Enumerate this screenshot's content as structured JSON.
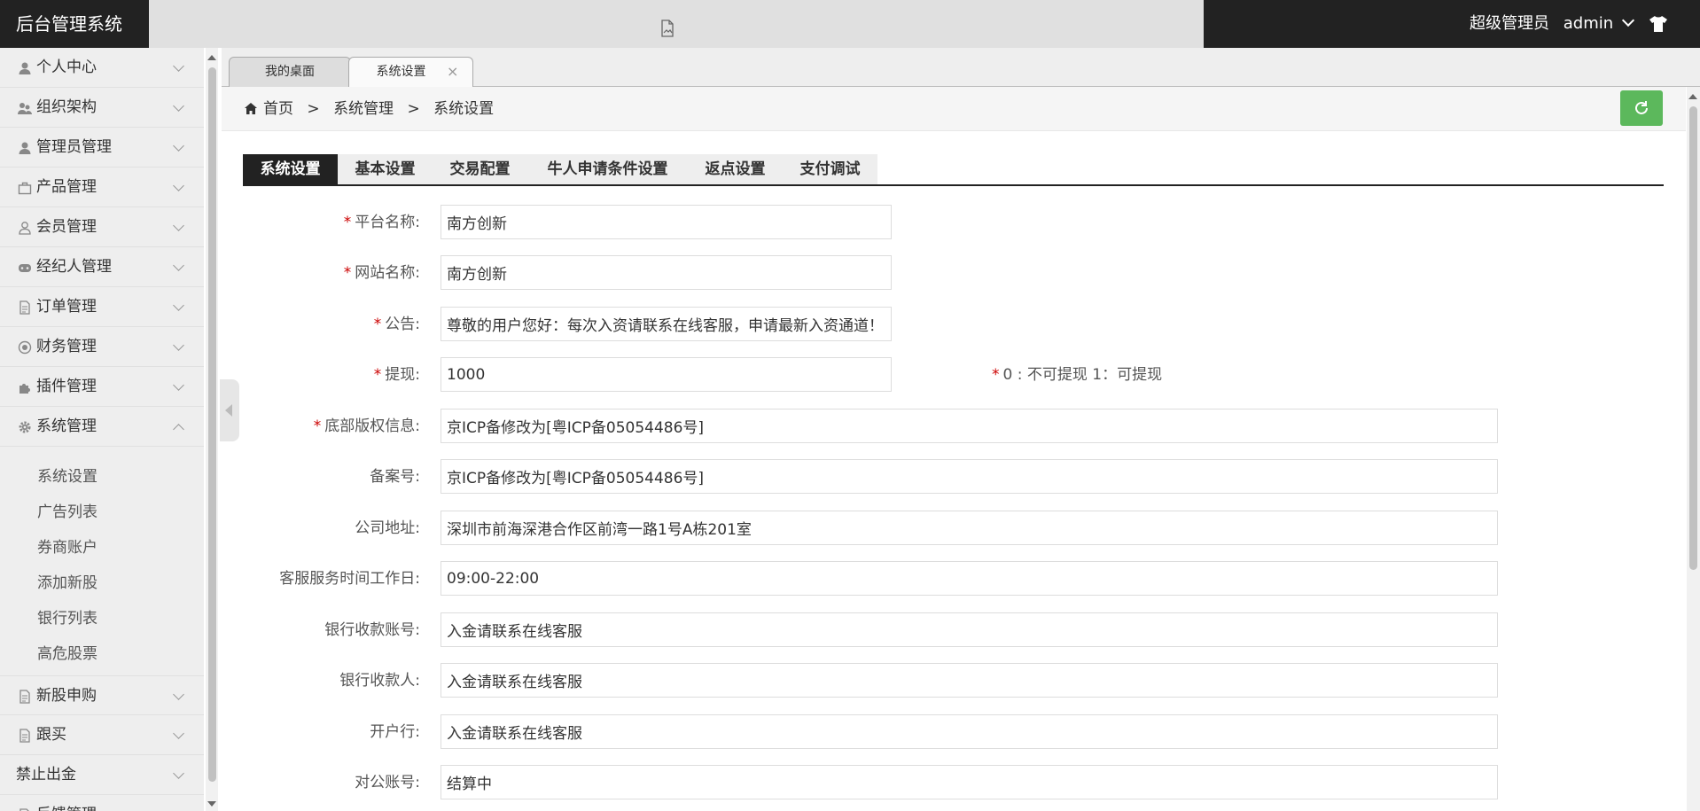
{
  "header": {
    "logo": "后台管理系统",
    "user_role": "超级管理员",
    "username": "admin"
  },
  "sidebar": {
    "items": [
      {
        "label": "个人中心",
        "icon": "user-icon"
      },
      {
        "label": "组织架构",
        "icon": "users-icon"
      },
      {
        "label": "管理员管理",
        "icon": "user-icon"
      },
      {
        "label": "产品管理",
        "icon": "briefcase-icon"
      },
      {
        "label": "会员管理",
        "icon": "user-outline-icon"
      },
      {
        "label": "经纪人管理",
        "icon": "gamepad-icon"
      },
      {
        "label": "订单管理",
        "icon": "document-icon"
      },
      {
        "label": "财务管理",
        "icon": "circle-dot-icon"
      },
      {
        "label": "插件管理",
        "icon": "puzzle-icon"
      },
      {
        "label": "系统管理",
        "icon": "gear-icon"
      }
    ],
    "sub_items": [
      "系统设置",
      "广告列表",
      "券商账户",
      "添加新股",
      "银行列表",
      "高危股票"
    ],
    "after_items": [
      {
        "label": "新股申购",
        "icon": "document-icon"
      },
      {
        "label": "跟买",
        "icon": "document-icon"
      },
      {
        "label": "禁止出金",
        "icon": ""
      },
      {
        "label": "反馈管理",
        "icon": "document-icon"
      }
    ]
  },
  "tabs": {
    "desktop": "我的桌面",
    "settings": "系统设置",
    "close": "×"
  },
  "breadcrumb": {
    "home": "首页",
    "sep": ">",
    "level1": "系统管理",
    "level2": "系统设置"
  },
  "subtabs": [
    "系统设置",
    "基本设置",
    "交易配置",
    "牛人申请条件设置",
    "返点设置",
    "支付调试"
  ],
  "form": {
    "required_mark": "*",
    "platform_name": {
      "label": "平台名称:",
      "value": "南方创新"
    },
    "site_name": {
      "label": "网站名称:",
      "value": "南方创新"
    },
    "notice": {
      "label": "公告:",
      "value": "尊敬的用户您好：每次入资请联系在线客服，申请最新入资通道！"
    },
    "withdraw": {
      "label": "提现:",
      "value": "1000",
      "hint": "0 : 不可提现 1：可提现"
    },
    "copyright": {
      "label": "底部版权信息:",
      "value": "京ICP备修改为[粤ICP备05054486号]"
    },
    "icp": {
      "label": "备案号:",
      "value": "京ICP备修改为[粤ICP备05054486号]"
    },
    "address": {
      "label": "公司地址:",
      "value": "深圳市前海深港合作区前湾一路1号A栋201室"
    },
    "service_time": {
      "label": "客服服务时间工作日:",
      "value": "09:00-22:00"
    },
    "bank_account": {
      "label": "银行收款账号:",
      "value": "入金请联系在线客服"
    },
    "bank_payee": {
      "label": "银行收款人:",
      "value": "入金请联系在线客服"
    },
    "bank_branch": {
      "label": "开户行:",
      "value": "入金请联系在线客服"
    },
    "corp_account": {
      "label": "对公账号:",
      "value": "结算中"
    }
  },
  "colors": {
    "header_bg": "#222222",
    "refresh_green": "#5cb85c",
    "required_red": "#cc0000"
  }
}
